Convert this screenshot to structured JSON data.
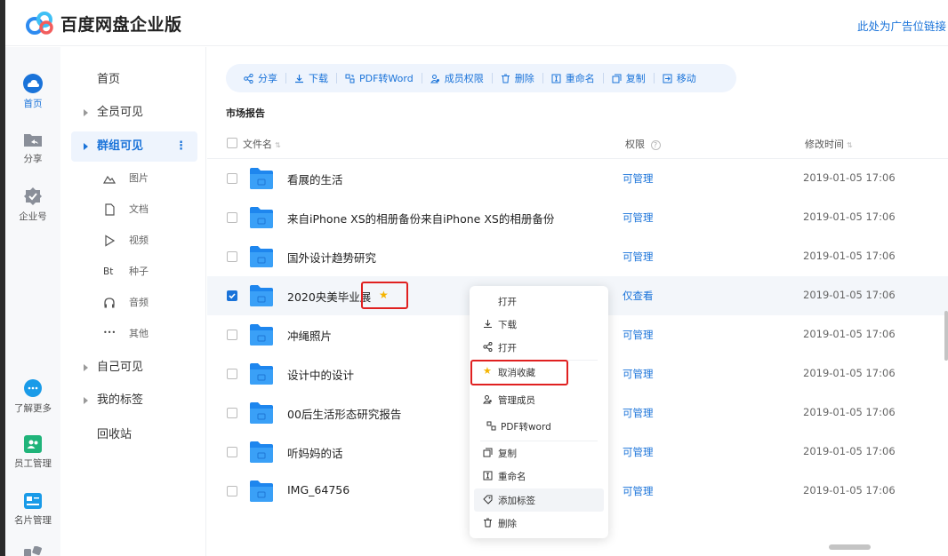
{
  "app": {
    "title": "百度网盘企业版",
    "ad_text": "此处为广告位链接"
  },
  "rail": [
    {
      "label": "首页",
      "icon": "cloud-home-icon"
    },
    {
      "label": "分享",
      "icon": "share-folder-icon"
    },
    {
      "label": "企业号",
      "icon": "enterprise-badge-icon"
    },
    {
      "label": "了解更多",
      "icon": "more-dots-icon"
    },
    {
      "label": "员工管理",
      "icon": "staff-icon"
    },
    {
      "label": "名片管理",
      "icon": "card-icon"
    }
  ],
  "nav": {
    "home": "首页",
    "all_visible": "全员可见",
    "group_visible": "群组可见",
    "group_more": "⋮",
    "sub": [
      {
        "label": "图片",
        "icon": "image-icon"
      },
      {
        "label": "文档",
        "icon": "document-icon"
      },
      {
        "label": "视频",
        "icon": "video-icon"
      },
      {
        "label": "种子",
        "icon": "torrent-icon",
        "glyph": "Bt"
      },
      {
        "label": "音频",
        "icon": "headphone-icon"
      },
      {
        "label": "其他",
        "icon": "ellipsis-icon",
        "glyph": "•••"
      }
    ],
    "self_visible": "自己可见",
    "my_tags": "我的标签",
    "recycle": "回收站"
  },
  "toolbar": {
    "share": "分享",
    "download": "下载",
    "pdf_word": "PDF转Word",
    "member_perm": "成员权限",
    "delete": "删除",
    "rename": "重命名",
    "copy": "复制",
    "move": "移动"
  },
  "breadcrumb": "市场报告",
  "table": {
    "col_name": "文件名",
    "col_perm": "权限",
    "col_time": "修改时间",
    "rows": [
      {
        "name": "看展的生活",
        "perm": "可管理",
        "time": "2019-01-05 17:06",
        "selected": false,
        "starred": false
      },
      {
        "name": "来自iPhone XS的相册备份来自iPhone XS的相册备份",
        "perm": "可管理",
        "time": "2019-01-05 17:06",
        "selected": false,
        "starred": false
      },
      {
        "name": "国外设计趋势研究",
        "perm": "可管理",
        "time": "2019-01-05 17:06",
        "selected": false,
        "starred": false
      },
      {
        "name": "2020央美毕业展",
        "perm": "仅查看",
        "time": "2019-01-05 17:06",
        "selected": true,
        "starred": true
      },
      {
        "name": "冲绳照片",
        "perm": "可管理",
        "time": "2019-01-05 17:06",
        "selected": false,
        "starred": false
      },
      {
        "name": "设计中的设计",
        "perm": "可管理",
        "time": "2019-01-05 17:06",
        "selected": false,
        "starred": false
      },
      {
        "name": "00后生活形态研究报告",
        "perm": "可管理",
        "time": "2019-01-05 17:06",
        "selected": false,
        "starred": false
      },
      {
        "name": "听妈妈的话",
        "perm": "可管理",
        "time": "2019-01-05 17:06",
        "selected": false,
        "starred": false
      },
      {
        "name": "IMG_64756",
        "perm": "可管理",
        "time": "2019-01-05 17:06",
        "selected": false,
        "starred": false
      }
    ]
  },
  "context_menu": {
    "open": "打开",
    "download": "下载",
    "share_open": "打开",
    "unfavorite": "取消收藏",
    "manage_members": "管理成员",
    "pdf_word": "PDF转word",
    "copy": "复制",
    "rename": "重命名",
    "add_tag": "添加标签",
    "delete": "删除"
  },
  "colors": {
    "accent": "#1a73d9",
    "highlight": "#e02020",
    "star": "#f5b400"
  }
}
